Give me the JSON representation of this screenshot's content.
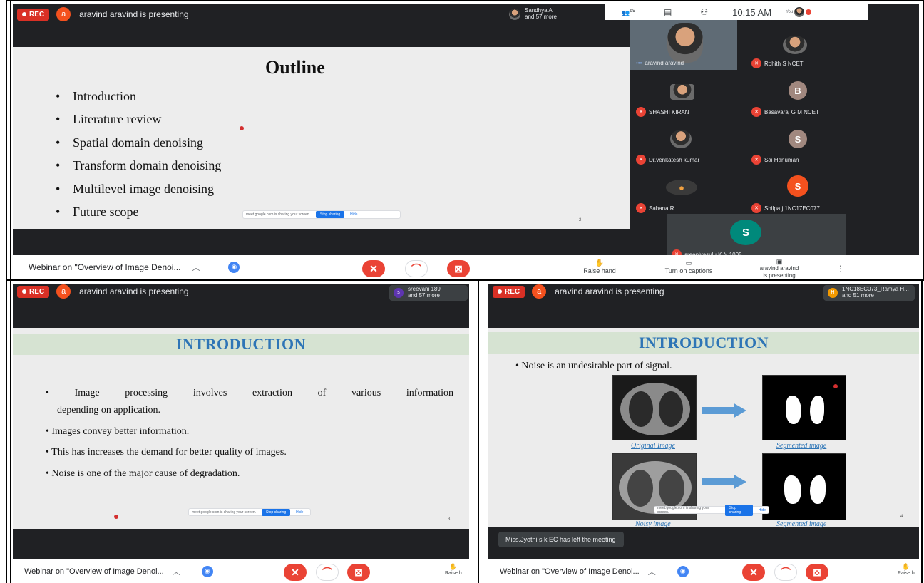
{
  "common": {
    "rec_label": "REC",
    "presenter_initial": "a",
    "presenting_text": "aravind aravind is presenting",
    "meeting_title": "Webinar on \"Overview of Image Denoi...",
    "share_notice": "meet.google.com is sharing your screen.",
    "stop_sharing": "Stop sharing",
    "hide": "Hide",
    "raise_hand": "Raise hand",
    "raise_hand_cut": "Raise h"
  },
  "panel1": {
    "participants_chip": {
      "line1": "Sandhya A",
      "line2": "and 57 more"
    },
    "participant_count": "69",
    "clock": "10:15 AM",
    "you_label": "You",
    "slide": {
      "title": "Outline",
      "bullets": [
        "Introduction",
        "Literature review",
        "Spatial domain denoising",
        "Transform domain denoising",
        "Multilevel image denoising",
        "Future scope"
      ],
      "page_number": "2"
    },
    "tiles": [
      {
        "name": "aravind aravind"
      },
      {
        "name": "Rohith S NCET"
      },
      {
        "name": "SHASHI KIRAN"
      },
      {
        "name": "Basavaraj G M NCET",
        "initial": "B",
        "color": "#a1887f"
      },
      {
        "name": "Dr.venkatesh kumar"
      },
      {
        "name": "Sai Hanuman",
        "initial": "S",
        "color": "#a1887f"
      },
      {
        "name": "Sahana R"
      },
      {
        "name": "Shilpa.j 1NC17EC077",
        "initial": "S",
        "color": "#f4511e"
      },
      {
        "name": "sreenivasulu K N 1005",
        "initial": "S",
        "color": "#00897b"
      }
    ],
    "bottom": {
      "captions": "Turn on captions",
      "presenting_line1": "aravind aravind",
      "presenting_line2": "is presenting"
    }
  },
  "panel2": {
    "participants_chip": {
      "line1": "sreevani 189",
      "line2": "and 57 more",
      "initial": "s"
    },
    "slide": {
      "title": "INTRODUCTION",
      "paragraphs": [
        "• Image processing involves extraction of various information",
        "depending on application.",
        "• Images convey better information.",
        "• This has increases the demand for better quality of images.",
        "• Noise is one of the major cause of degradation."
      ],
      "page_number": "3"
    }
  },
  "panel3": {
    "participants_chip": {
      "line1": "1NC18EC073_Ramya H...",
      "line2": "and 51 more",
      "initial": "H"
    },
    "slide": {
      "title": "INTRODUCTION",
      "bullet": "• Noise is an undesirable part of signal.",
      "captions": [
        "Original Image",
        "Segmented image",
        "Noisy image",
        "Segmented image"
      ],
      "page_number": "4"
    },
    "toast": "Miss.Jyothi s k EC has left the meeting"
  },
  "colors": {
    "accent_red": "#ea4335",
    "meet_dark": "#202124",
    "slide_blue": "#2e75b6"
  }
}
